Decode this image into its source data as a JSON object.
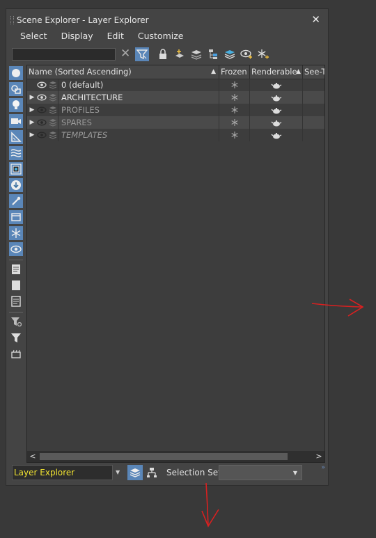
{
  "window": {
    "title": "Scene Explorer - Layer Explorer",
    "close_glyph": "✕"
  },
  "menu": [
    "Select",
    "Display",
    "Edit",
    "Customize"
  ],
  "toolbar": {
    "search_value": "",
    "clear_glyph": "✕"
  },
  "grid": {
    "columns": [
      {
        "label": "Name (Sorted Ascending)",
        "sort": "▲"
      },
      {
        "label": "Frozen",
        "sort": ""
      },
      {
        "label": "Renderable",
        "sort": "▲"
      },
      {
        "label": "See-Th",
        "sort": ""
      }
    ],
    "rows": [
      {
        "name": "0 (default)",
        "expander": "",
        "visible": true,
        "style": "normal",
        "alt": false
      },
      {
        "name": "ARCHITECTURE",
        "expander": "▶",
        "visible": true,
        "style": "normal",
        "alt": true
      },
      {
        "name": "PROFILES",
        "expander": "▶",
        "visible": false,
        "style": "dim",
        "alt": false
      },
      {
        "name": "SPARES",
        "expander": "▶",
        "visible": false,
        "style": "dim",
        "alt": true
      },
      {
        "name": "TEMPLATES",
        "expander": "▶",
        "visible": false,
        "style": "italic",
        "alt": false
      }
    ],
    "scroll_left_glyph": "<",
    "scroll_right_glyph": ">"
  },
  "bottom": {
    "explorer_name": "Layer Explorer",
    "selection_label": "Selection Set:",
    "more_glyph": "»"
  },
  "colors": {
    "accent": "#5a86b8",
    "explorer_text": "#f0e230",
    "annotation": "#d92020"
  }
}
